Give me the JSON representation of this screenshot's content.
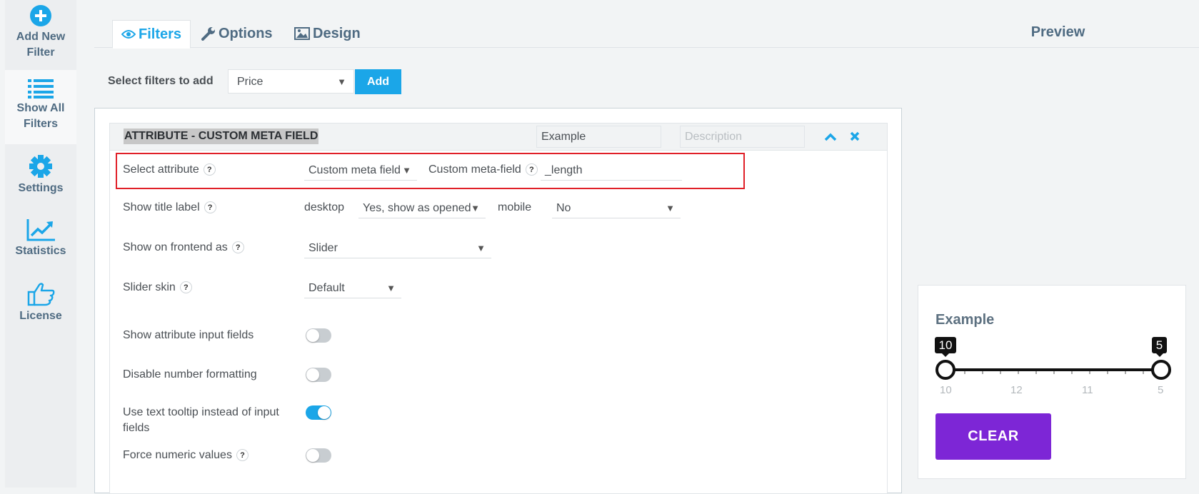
{
  "sidebar": {
    "items": [
      {
        "label1": "Add New",
        "label2": "Filter",
        "icon": "plus-circle-icon"
      },
      {
        "label1": "Show All",
        "label2": "Filters",
        "icon": "list-icon"
      },
      {
        "label1": "Settings",
        "label2": "",
        "icon": "gear-icon"
      },
      {
        "label1": "Statistics",
        "label2": "",
        "icon": "chart-line-icon"
      },
      {
        "label1": "License",
        "label2": "",
        "icon": "hand-pointer-icon"
      }
    ]
  },
  "tabs": {
    "filters": "Filters",
    "options": "Options",
    "design": "Design"
  },
  "preview_title": "Preview",
  "add_row": {
    "label": "Select filters to add",
    "selected": "Price",
    "button": "Add"
  },
  "filter": {
    "title": "ATTRIBUTE - CUSTOM META FIELD",
    "name_value": "Example",
    "description_placeholder": "Description",
    "rows": {
      "select_attribute": {
        "label": "Select attribute",
        "value": "Custom meta field",
        "meta_label": "Custom meta-field",
        "meta_value": "_length"
      },
      "show_title_label": {
        "label": "Show title label",
        "desktop_label": "desktop",
        "desktop_value": "Yes, show as opened",
        "mobile_label": "mobile",
        "mobile_value": "No"
      },
      "show_on_frontend": {
        "label": "Show on frontend as",
        "value": "Slider"
      },
      "slider_skin": {
        "label": "Slider skin",
        "value": "Default"
      },
      "show_attr_inputs": {
        "label": "Show attribute input fields",
        "on": false
      },
      "disable_number_format": {
        "label": "Disable number formatting",
        "on": false
      },
      "text_tooltip": {
        "label1": "Use text tooltip instead of input",
        "label2": "fields",
        "on": true
      },
      "force_numeric": {
        "label": "Force numeric values",
        "on": false
      }
    }
  },
  "preview": {
    "title": "Example",
    "min_tip": "10",
    "max_tip": "5",
    "ticks": [
      "10",
      "12",
      "11",
      "5"
    ],
    "clear_button": "CLEAR"
  },
  "colors": {
    "accent": "#1ba6e8",
    "clear_button": "#7d26d6",
    "highlight_border": "#e02028"
  }
}
